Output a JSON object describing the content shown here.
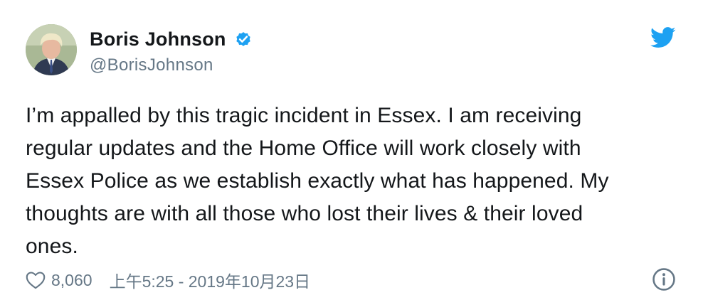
{
  "author": {
    "display_name": "Boris Johnson",
    "handle": "@BorisJohnson",
    "verified": true,
    "verified_icon": "verified-badge-icon",
    "avatar": "profile-photo"
  },
  "tweet": {
    "text": "I’m appalled by this tragic incident in Essex. I am receiving\nregular updates and the Home Office will work closely with\nEssex Police as we establish exactly what has happened. My\nthoughts are with all those who lost their lives & their loved\nones."
  },
  "footer": {
    "likes": "8,060",
    "timestamp": "上午5:25 - 2019年10月23日",
    "like_icon": "heart-icon",
    "info_icon": "info-icon"
  },
  "brand": {
    "icon": "twitter-bird-icon",
    "accent": "#1da1f2",
    "secondary_text": "#657786",
    "primary_text": "#14171a"
  }
}
